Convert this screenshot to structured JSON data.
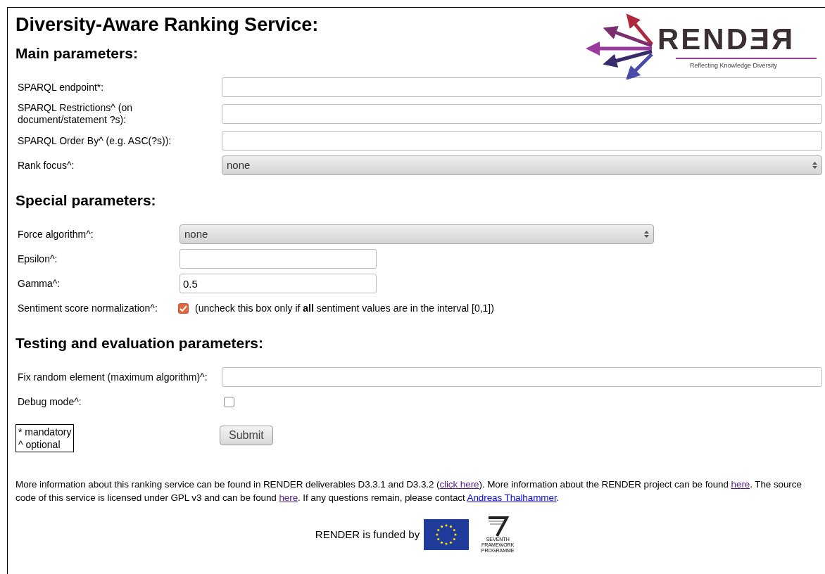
{
  "title": "Diversity-Aware Ranking Service:",
  "logo": {
    "wordmark": "RENDƎЯ",
    "tagline": "Reflecting Knowledge Diversity"
  },
  "sections": [
    {
      "heading": "Main parameters:",
      "fields": [
        {
          "kind": "text",
          "label": "SPARQL endpoint*:"
        },
        {
          "kind": "text",
          "label": "SPARQL Restrictions^ (on document/statement ?s):"
        },
        {
          "kind": "text",
          "label": "SPARQL Order By^ (e.g. ASC(?s)):"
        },
        {
          "kind": "select",
          "label": "Rank focus^:",
          "value": "none"
        }
      ]
    },
    {
      "heading": "Special parameters:",
      "fields": [
        {
          "kind": "select",
          "label": "Force algorithm^:",
          "value": "none"
        },
        {
          "kind": "text",
          "label": "Epsilon^:"
        },
        {
          "kind": "text",
          "label": "Gamma^:",
          "value": "0.5"
        },
        {
          "kind": "checkbox",
          "label": "Sentiment score normalization^:",
          "checked": true,
          "note": "(uncheck this box only if **all** sentiment values are in the interval [0,1])"
        }
      ]
    },
    {
      "heading": "Testing and evaluation parameters:",
      "fields": [
        {
          "kind": "text",
          "label": "Fix random element (maximum algorithm)^:"
        },
        {
          "kind": "checkbox",
          "label": "Debug mode^:",
          "checked": false
        }
      ]
    }
  ],
  "legend": [
    "* mandatory",
    "^ optional"
  ],
  "submit": "Submit",
  "footer": [
    {
      "text": "More information about this ranking service can be found in RENDER deliverables D3.3.1 and D3.3.2 ("
    },
    {
      "link": "click here",
      "visited": true
    },
    {
      "text": "). More information about the RENDER project can be found "
    },
    {
      "link": "here",
      "visited": true
    },
    {
      "text": ". The source code of this service is licensed under GPL v3 and can be found "
    },
    {
      "link": "here",
      "visited": true
    },
    {
      "text": ". If any questions remain, please contact "
    },
    {
      "link": "Andreas Thalhammer",
      "visited": false
    },
    {
      "text": "."
    }
  ],
  "funded_by": "RENDER is funded by",
  "fp7_caption": "SEVENTH FRAMEWORK PROGRAMME"
}
